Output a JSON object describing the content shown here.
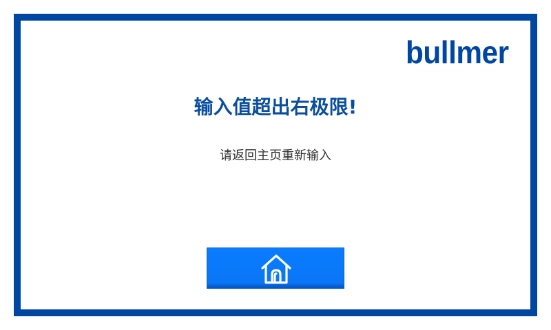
{
  "brand": {
    "logo_text": "bullmer",
    "color": "#0047a4"
  },
  "alert": {
    "title": "输入值超出右极限!",
    "message": "请返回主页重新输入"
  },
  "home_button": {
    "icon": "home-icon",
    "color": "#0a7cff"
  },
  "colors": {
    "frame": "#0047a4",
    "title": "#0a4ea0",
    "message": "#333333",
    "background": "#ffffff"
  }
}
